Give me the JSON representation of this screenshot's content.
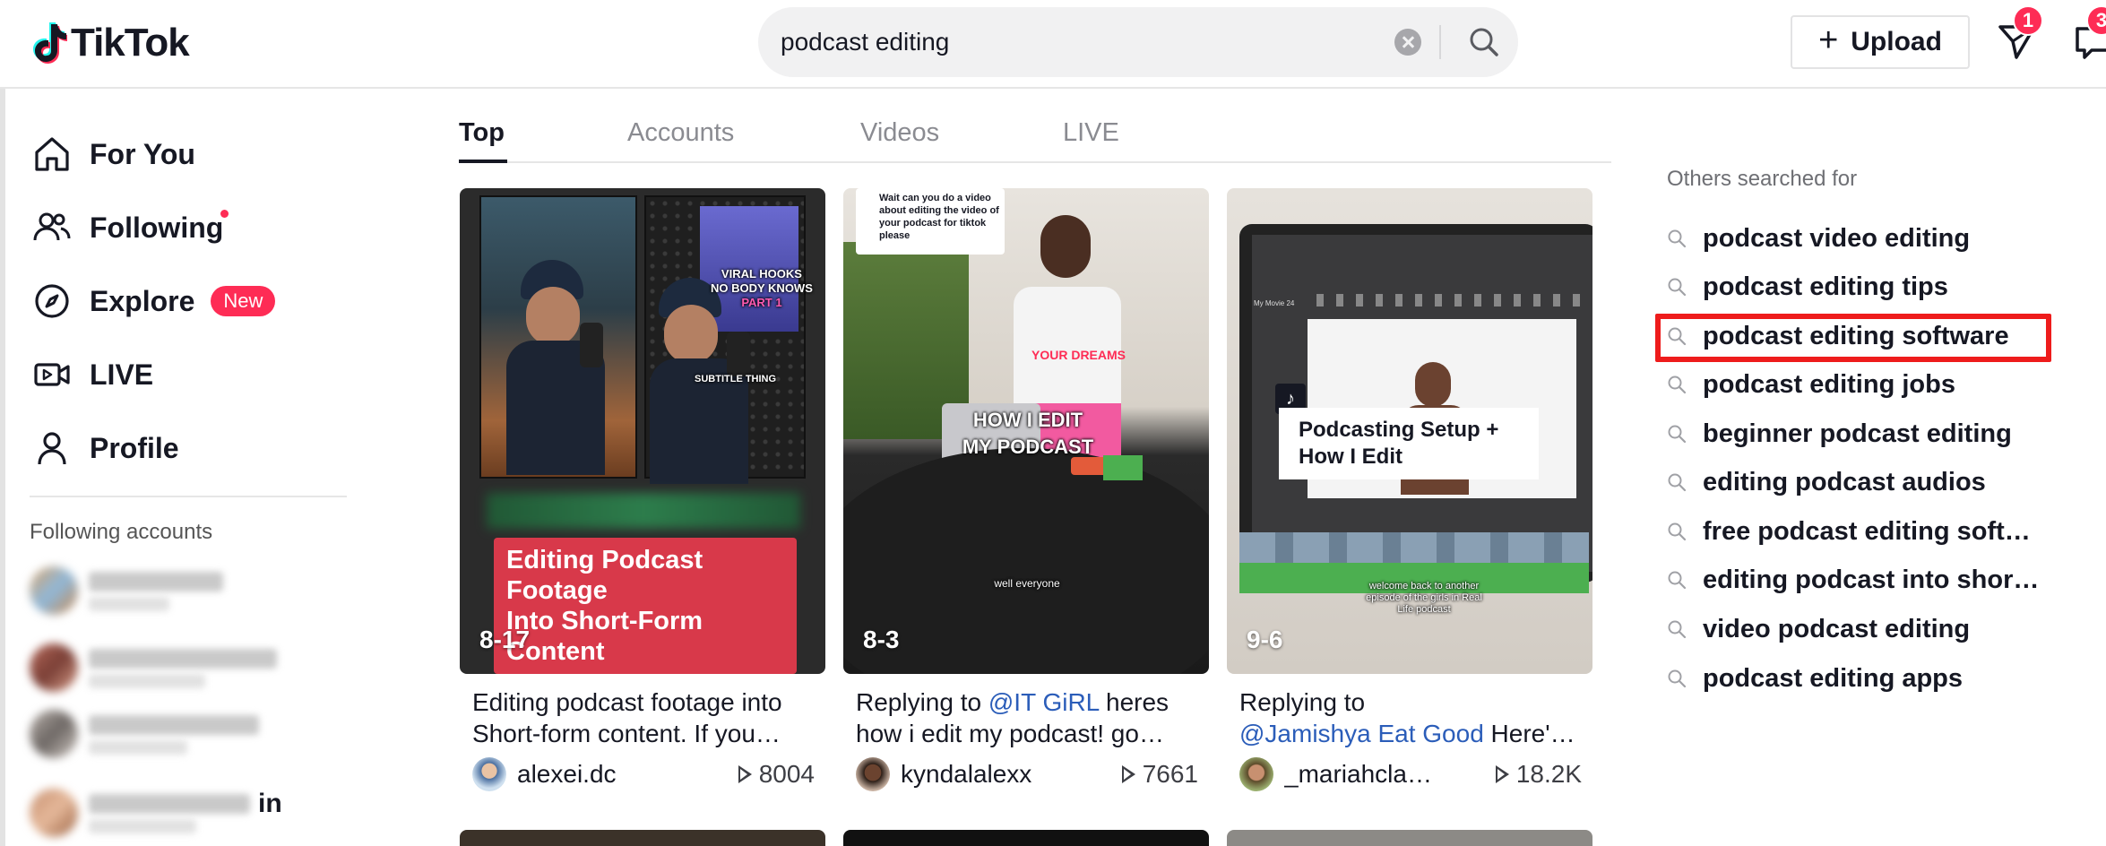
{
  "brand": {
    "name": "TikTok"
  },
  "search": {
    "value": "podcast editing",
    "placeholder": "Search"
  },
  "header": {
    "upload_label": "Upload",
    "inbox_badge": "1",
    "messages_badge": "3"
  },
  "sidebar": {
    "nav": [
      {
        "label": "For You",
        "icon": "home-icon"
      },
      {
        "label": "Following",
        "icon": "following-icon"
      },
      {
        "label": "Explore",
        "icon": "compass-icon",
        "badge": "New"
      },
      {
        "label": "LIVE",
        "icon": "live-icon"
      },
      {
        "label": "Profile",
        "icon": "profile-icon"
      }
    ],
    "following_title": "Following accounts",
    "partial_account_text": "in"
  },
  "tabs": [
    "Top",
    "Accounts",
    "Videos",
    "LIVE"
  ],
  "videos": [
    {
      "thumb_title": "Editing Podcast Footage\nInto Short-Form Content",
      "thumb_small_1": "VIRAL HOOKS",
      "thumb_small_2": "NO BODY KNOWS",
      "thumb_small_3": "PART 1",
      "thumb_small_4": "SUBTITLE THING",
      "date": "8-17",
      "caption": "Editing podcast footage into Short-form content. If you…",
      "user": "alexei.dc",
      "views": "8004"
    },
    {
      "thumb_question": "Wait can you do a video about editing the video of your podcast for tiktok please",
      "thumb_overlay_1": "HOW I EDIT",
      "thumb_overlay_2": "MY PODCAST",
      "thumb_subtitle": "well everyone",
      "thumb_shirt": "YOUR DREAMS",
      "date": "8-3",
      "caption_prefix": "Replying to ",
      "caption_mention": "@IT GiRL",
      "caption_rest": " heres how i edit my podcast! go…",
      "user": "kyndalalexx",
      "views": "7661"
    },
    {
      "thumb_card": "Podcasting Setup +\nHow I Edit",
      "thumb_subtitle_1": "welcome back to another",
      "thumb_subtitle_2": "episode of the girls in Real",
      "thumb_subtitle_3": "Life podcast",
      "thumb_app": "My Movie 24",
      "date": "9-6",
      "caption_prefix": "Replying to",
      "caption_mention": "@Jamishya Eat Good",
      "caption_rest": " Here'…",
      "user": "_mariahcla…",
      "views": "18.2K"
    }
  ],
  "others_searched": {
    "title": "Others searched for",
    "items": [
      "podcast video editing",
      "podcast editing tips",
      "podcast editing software",
      "podcast editing jobs",
      "beginner podcast editing",
      "editing podcast audios",
      "free podcast editing soft…",
      "editing podcast into shor…",
      "video podcast editing",
      "podcast editing apps"
    ],
    "highlighted_index": 2,
    "highlight_color": "#ee1c1c"
  },
  "colors": {
    "accent": "#fe2c55",
    "mention": "#2b5db9"
  }
}
